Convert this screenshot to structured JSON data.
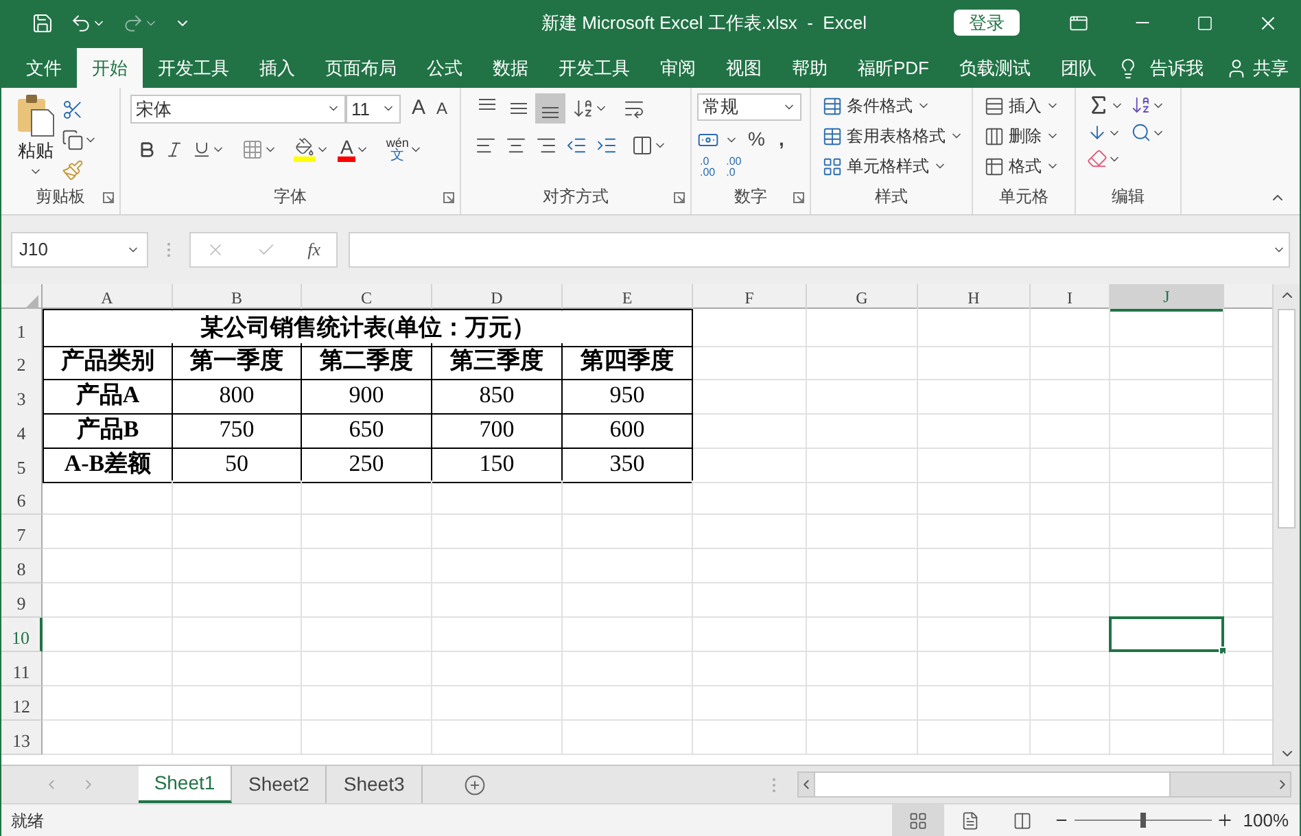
{
  "title_bar": {
    "title": "新建 Microsoft Excel 工作表.xlsx  -  Excel",
    "login_button": "登录"
  },
  "ribbon_tabs": [
    {
      "label": "文件",
      "selected": false
    },
    {
      "label": "开始",
      "selected": true
    },
    {
      "label": "开发工具",
      "selected": false
    },
    {
      "label": "插入",
      "selected": false
    },
    {
      "label": "页面布局",
      "selected": false
    },
    {
      "label": "公式",
      "selected": false
    },
    {
      "label": "数据",
      "selected": false
    },
    {
      "label": "开发工具",
      "selected": false
    },
    {
      "label": "审阅",
      "selected": false
    },
    {
      "label": "视图",
      "selected": false
    },
    {
      "label": "帮助",
      "selected": false
    },
    {
      "label": "福昕PDF",
      "selected": false
    },
    {
      "label": "负载测试",
      "selected": false
    },
    {
      "label": "团队",
      "selected": false
    }
  ],
  "tell_me": "告诉我",
  "share": "共享",
  "clipboard": {
    "paste": "粘贴",
    "label": "剪贴板"
  },
  "font": {
    "font_name": "宋体",
    "font_size": "11",
    "grow": "A",
    "shrink": "A",
    "font_color": "A",
    "phonetic_top": "wén",
    "phonetic_bottom": "文",
    "label": "字体"
  },
  "alignment": {
    "vertical": [
      {
        "selected": false
      },
      {
        "selected": false
      },
      {
        "selected": true
      }
    ],
    "label": "对齐方式"
  },
  "number": {
    "format": "常规",
    "percent": "%",
    "comma": ",",
    "decimal_increase": [
      ".0",
      ".00"
    ],
    "decimal_decrease": [
      ".00",
      ".0"
    ],
    "label": "数字"
  },
  "styles": {
    "items": [
      "条件格式",
      "套用表格格式",
      "单元格样式"
    ],
    "label": "样式"
  },
  "cells": {
    "items": [
      "插入",
      "删除",
      "格式"
    ],
    "label": "单元格"
  },
  "editing": {
    "label": "编辑"
  },
  "formula_bar": {
    "name_box": "J10",
    "fx": "fx"
  },
  "sheet": {
    "columns": [
      {
        "label": "A",
        "selected": false
      },
      {
        "label": "B",
        "selected": false
      },
      {
        "label": "C",
        "selected": false
      },
      {
        "label": "D",
        "selected": false
      },
      {
        "label": "E",
        "selected": false
      },
      {
        "label": "F",
        "selected": false
      },
      {
        "label": "G",
        "selected": false
      },
      {
        "label": "H",
        "selected": false
      },
      {
        "label": "I",
        "selected": false
      },
      {
        "label": "J",
        "selected": true
      }
    ],
    "rows": [
      {
        "label": "1",
        "selected": false
      },
      {
        "label": "2",
        "selected": false
      },
      {
        "label": "3",
        "selected": false
      },
      {
        "label": "4",
        "selected": false
      },
      {
        "label": "5",
        "selected": false
      },
      {
        "label": "6",
        "selected": false
      },
      {
        "label": "7",
        "selected": false
      },
      {
        "label": "8",
        "selected": false
      },
      {
        "label": "9",
        "selected": false
      },
      {
        "label": "10",
        "selected": true
      },
      {
        "label": "11",
        "selected": false
      },
      {
        "label": "12",
        "selected": false
      },
      {
        "label": "13",
        "selected": false
      }
    ],
    "table": {
      "title": "某公司销售统计表(单位：万元）",
      "header": [
        "产品类别",
        "第一季度",
        "第二季度",
        "第三季度",
        "第四季度"
      ],
      "rows": [
        {
          "label": "产品A",
          "values": [
            "800",
            "900",
            "850",
            "950"
          ]
        },
        {
          "label": "产品B",
          "values": [
            "750",
            "650",
            "700",
            "600"
          ]
        },
        {
          "label": "A-B差额",
          "values": [
            "50",
            "250",
            "150",
            "350"
          ]
        }
      ]
    }
  },
  "sheet_tabs": [
    {
      "label": "Sheet1",
      "selected": true
    },
    {
      "label": "Sheet2",
      "selected": false
    },
    {
      "label": "Sheet3",
      "selected": false
    }
  ],
  "status_bar": {
    "status": "就绪",
    "zoom": "100%",
    "zoom_slider": {
      "level": 0.5
    }
  }
}
